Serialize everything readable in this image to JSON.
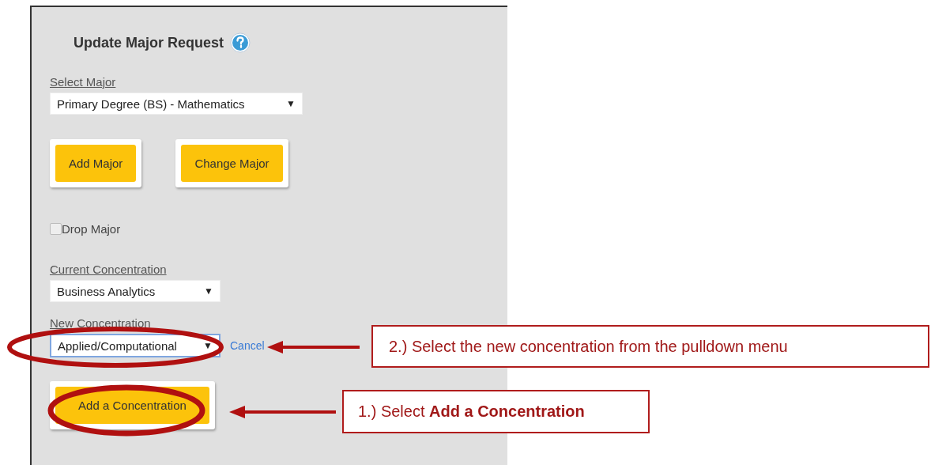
{
  "form": {
    "title": "Update Major Request",
    "select_major": {
      "label": "Select Major",
      "value": "Primary Degree (BS) - Mathematics",
      "caret": "▼"
    },
    "major_buttons": [
      "Add Major",
      "Change Major"
    ],
    "drop_major": {
      "label": "Drop Major",
      "checked": false
    },
    "current_concentration": {
      "label": "Current Concentration",
      "value": "Business Analytics",
      "caret": "▼"
    },
    "new_concentration": {
      "label": "New Concentration",
      "value": "Applied/Computational",
      "caret": "▼",
      "focused": true,
      "cancel_link": "Cancel"
    },
    "add_concentration_button": "Add a Concentration"
  },
  "annotations": [
    {
      "text": "2.) Select the new concentration from the pulldown menu"
    },
    {
      "text": "1.) Select **Add a Concentration**"
    }
  ]
}
